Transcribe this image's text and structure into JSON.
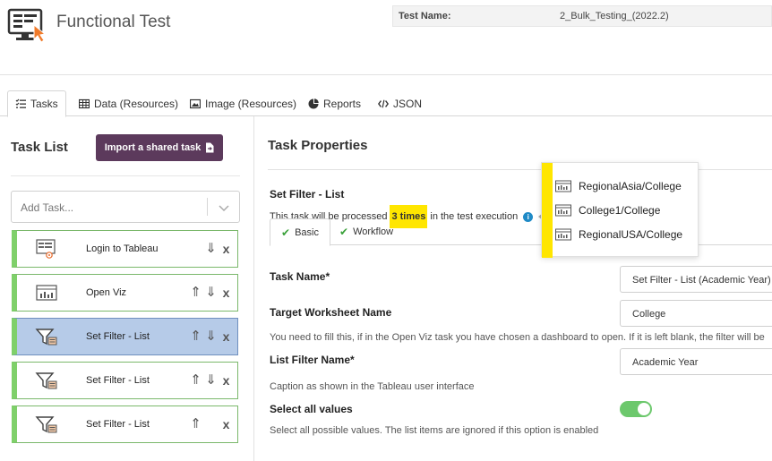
{
  "header": {
    "app_title": "Functional Test",
    "test_name_label": "Test Name:",
    "test_name_value": "2_Bulk_Testing_(2022.2)"
  },
  "tabs": [
    {
      "label": "Tasks",
      "icon": "list-check-icon",
      "active": true
    },
    {
      "label": "Data (Resources)",
      "icon": "table-icon",
      "active": false
    },
    {
      "label": "Image (Resources)",
      "icon": "image-icon",
      "active": false
    },
    {
      "label": "Reports",
      "icon": "pie-chart-icon",
      "active": false
    },
    {
      "label": "JSON",
      "icon": "code-icon",
      "active": false
    }
  ],
  "task_list": {
    "title": "Task List",
    "import_button": "Import a shared task",
    "add_task_placeholder": "Add Task...",
    "items": [
      {
        "label": "Login to Tableau",
        "icon": "login-screen-icon",
        "selected": false
      },
      {
        "label": "Open Viz",
        "icon": "viz-window-icon",
        "selected": false
      },
      {
        "label": "Set Filter - List",
        "icon": "filter-list-icon",
        "selected": true
      },
      {
        "label": "Set Filter - List",
        "icon": "filter-list-icon",
        "selected": false
      },
      {
        "label": "Set Filter - List",
        "icon": "filter-list-icon",
        "selected": false
      }
    ]
  },
  "properties": {
    "title": "Task Properties",
    "filter_heading": "Set Filter - List",
    "process_prefix": "This task will be processed",
    "process_highlight": "3 times",
    "process_suffix": "in the test execution",
    "subtabs": [
      {
        "label": "Basic",
        "active": true
      },
      {
        "label": "Workflow",
        "active": false
      }
    ],
    "task_name_label": "Task Name*",
    "task_name_value": "Set Filter - List (Academic Year)",
    "worksheet_label": "Target Worksheet Name",
    "worksheet_value": "College",
    "worksheet_help": "You need to fill this, if in the Open Viz task you have chosen a dashboard to open. If it is left blank, the filter will be",
    "filter_name_label": "List Filter Name*",
    "filter_name_value": "Academic Year",
    "filter_name_help": "Caption as shown in the Tableau user interface",
    "select_all_label": "Select all values",
    "select_all_enabled": true,
    "select_all_help": "Select all possible values. The list items are ignored if this option is enabled"
  },
  "popup": {
    "items": [
      "RegionalAsia/College",
      "College1/College",
      "RegionalUSA/College"
    ]
  },
  "colors": {
    "accent_purple": "#5c3a5c",
    "highlight_yellow": "#ffe600",
    "task_border_green": "#7fd06a",
    "selected_blue": "#b6cbe8",
    "toggle_green": "#6cc86c"
  }
}
